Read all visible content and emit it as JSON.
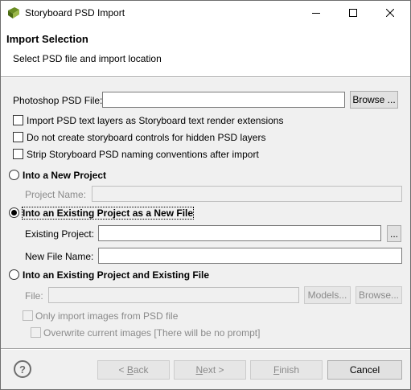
{
  "window": {
    "title": "Storyboard PSD Import"
  },
  "header": {
    "title": "Import Selection",
    "subtitle": "Select PSD file and import location"
  },
  "psd_file": {
    "label": "Photoshop PSD File:",
    "value": "",
    "browse_label": "Browse ..."
  },
  "options": [
    {
      "label": "Import PSD text layers as Storyboard text render extensions",
      "checked": false
    },
    {
      "label": "Do not create storyboard controls for hidden PSD layers",
      "checked": false
    },
    {
      "label": "Strip Storyboard PSD naming conventions after import",
      "checked": false
    }
  ],
  "new_project": {
    "radio_label": "Into a New Project",
    "selected": false,
    "project_name_label": "Project Name:",
    "project_name_value": ""
  },
  "existing_new_file": {
    "radio_label": "Into an Existing Project as a New File",
    "selected": true,
    "existing_project_label": "Existing Project:",
    "existing_project_value": "",
    "browse_label": "...",
    "new_file_name_label": "New File Name:",
    "new_file_name_value": ""
  },
  "existing_file": {
    "radio_label": "Into an Existing Project and Existing File",
    "selected": false,
    "file_label": "File:",
    "file_value": "",
    "models_label": "Models...",
    "browse_label": "Browse...",
    "only_images_label": "Only import images from PSD file",
    "overwrite_label": "Overwrite current images [There will be no prompt]"
  },
  "footer": {
    "help_icon": "?",
    "back_prefix": "< ",
    "back_mnemonic": "B",
    "back_rest": "ack",
    "next_mnemonic": "N",
    "next_rest": "ext >",
    "finish_mnemonic": "F",
    "finish_rest": "inish",
    "cancel_label": "Cancel"
  }
}
